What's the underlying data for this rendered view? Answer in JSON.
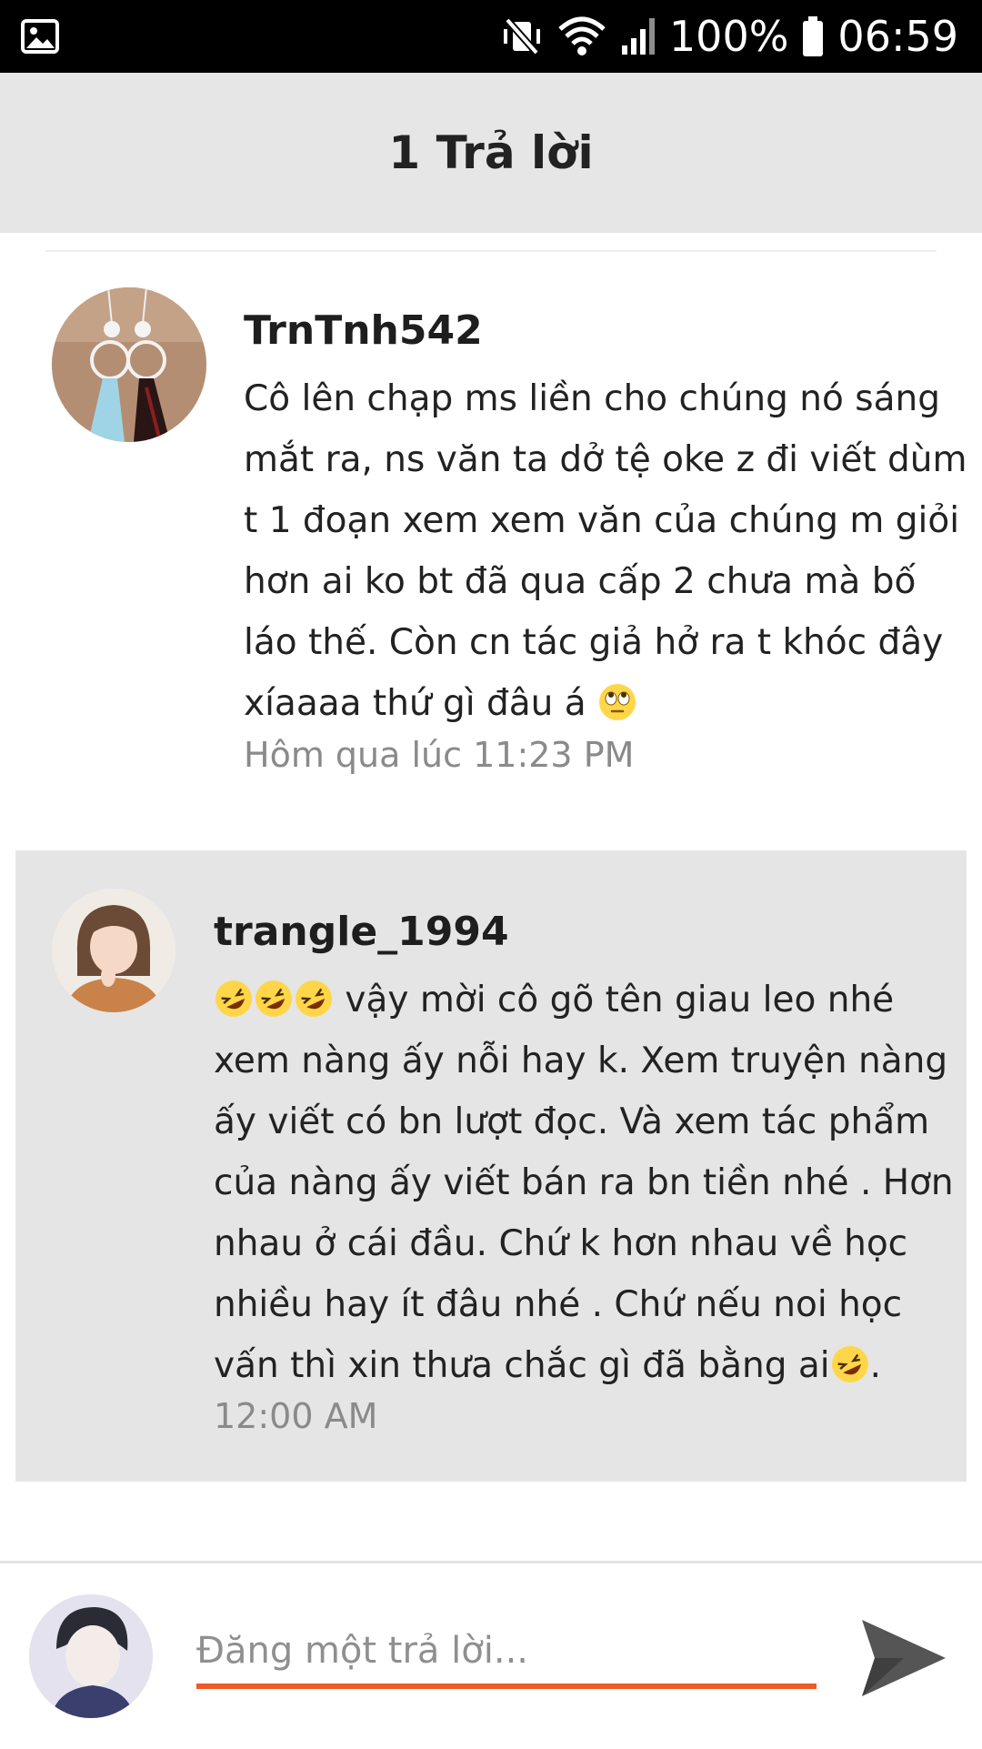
{
  "status_bar": {
    "gallery_icon": "image-icon",
    "mute_icon": "vibrate-mute-icon",
    "wifi_icon": "wifi-icon",
    "signal_icon": "signal-icon",
    "battery_percent": "100%",
    "battery_icon": "battery-icon",
    "time": "06:59"
  },
  "header": {
    "title": "1 Trả lời"
  },
  "comments": [
    {
      "username": "TrnTnh542",
      "lines": [
        "Cô lên chạp ms liền cho chúng nó sáng",
        "mắt ra, ns văn ta dở tệ oke z đi viết dùm",
        "t 1 đoạn xem xem văn của chúng m giỏi",
        "hơn ai ko bt đã qua cấp 2 chưa mà bố",
        "láo thế. Còn cn tác giả hở ra t khóc đây",
        "xíaaaa thứ gì đâu á"
      ],
      "trailing_emoji": "eye-roll-emoji",
      "timestamp": "Hôm qua lúc 11:23 PM"
    },
    {
      "username": "trangle_1994",
      "lines": [
        " vậy mời cô gõ tên giau leo  nhé",
        "xem nàng ấy nỗi hay k. Xem truyện nàng",
        "ấy viết có bn lượt đọc. Và xem tác phẩm",
        "của nàng ấy viết bán ra bn tiền nhé . Hơn",
        "nhau ở cái đầu. Chứ k hơn nhau về học",
        "nhiều hay ít đâu nhé . Chứ nếu noi học",
        "vấn thì xin thưa chắc gì đã bằng ai"
      ],
      "leading_emoji": "rofl-emoji",
      "leading_emoji_count": 3,
      "line7_suffix": ".",
      "timestamp": "12:00 AM"
    }
  ],
  "reply": {
    "placeholder": "Đăng một trả lời...",
    "send_icon": "send-icon"
  },
  "colors": {
    "accent": "#ee5a24",
    "header_bg": "#e6e6e6",
    "highlight_bg": "#e5e5e5",
    "timestamp": "#8a8a8a"
  }
}
